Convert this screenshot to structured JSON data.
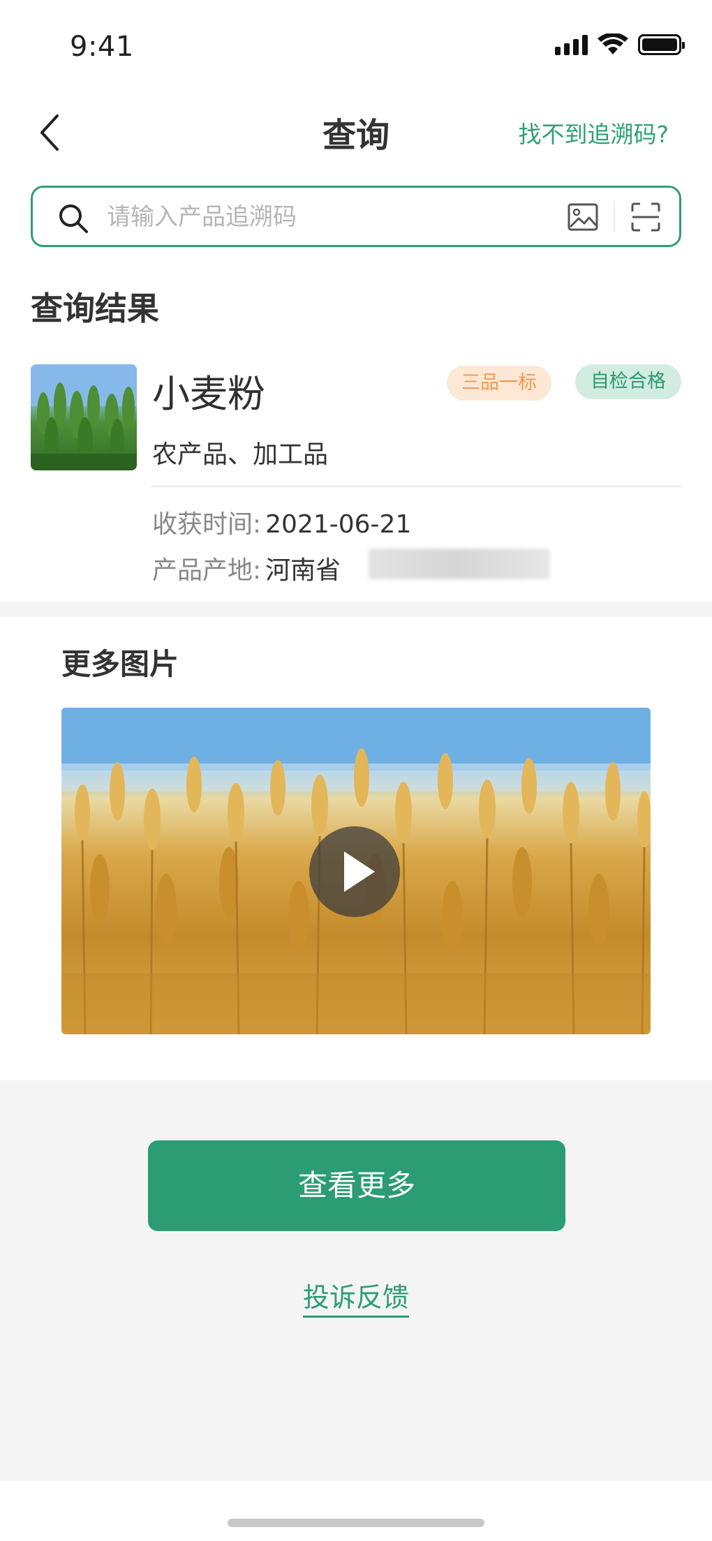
{
  "status_bar": {
    "time": "9:41"
  },
  "nav": {
    "title": "查询",
    "right_link": "找不到追溯码?"
  },
  "search": {
    "placeholder": "请输入产品追溯码",
    "value": ""
  },
  "result": {
    "section_title": "查询结果",
    "product": {
      "name": "小麦粉",
      "badge_1": "三品一标",
      "badge_2": "自检合格",
      "category": "农产品、加工品",
      "harvest_label": "收获时间:",
      "harvest_value": "2021-06-21",
      "origin_label": "产品产地:",
      "origin_value": "河南省"
    }
  },
  "more": {
    "title": "更多图片"
  },
  "actions": {
    "view_more": "查看更多",
    "feedback": "投诉反馈"
  },
  "colors": {
    "accent": "#2b9c74",
    "badge_orange_bg": "#fde8d6",
    "badge_orange_text": "#f39a4c",
    "badge_green_bg": "#d3ece1",
    "badge_green_text": "#2b9a6e"
  }
}
